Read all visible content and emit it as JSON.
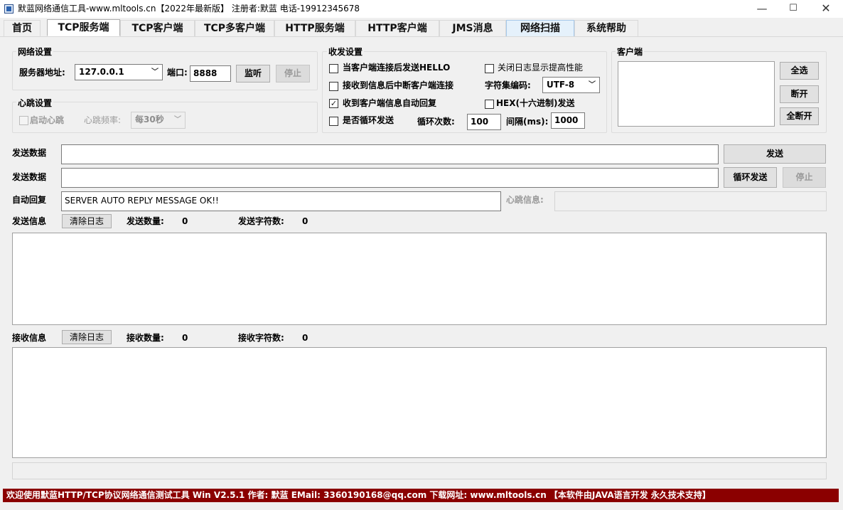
{
  "window": {
    "title": "默蓝网络通信工具-www.mltools.cn【2022年最新版】 注册者:默蓝 电话-19912345678",
    "min": "—",
    "max": "☐",
    "close": "✕"
  },
  "tabs": [
    "首页",
    "TCP服务端",
    "TCP客户端",
    "TCP多客户端",
    "HTTP服务端",
    "HTTP客户端",
    "JMS消息",
    "网络扫描",
    "系统帮助"
  ],
  "active_tab": "TCP服务端",
  "network": {
    "title": "网络设置",
    "server_label": "服务器地址:",
    "server_value": "127.0.0.1",
    "port_label": "端口:",
    "port_value": "8888",
    "listen_btn": "监听",
    "stop_btn": "停止"
  },
  "heartbeat": {
    "title": "心跳设置",
    "enable_label": "启动心跳",
    "freq_label": "心跳频率:",
    "freq_value": "每30秒"
  },
  "txrx": {
    "title": "收发设置",
    "hello_label": "当客户端连接后发送HELLO",
    "close_log_label": "关闭日志显示提高性能",
    "disconnect_label": "接收到信息后中断客户端连接",
    "charset_label": "字符集编码:",
    "charset_value": "UTF-8",
    "auto_reply_label": "收到客户端信息自动回复",
    "auto_reply_checked": true,
    "hex_label": "HEX(十六进制)发送",
    "loop_label": "是否循环发送",
    "loop_count_label": "循环次数:",
    "loop_count_value": "100",
    "interval_label": "间隔(ms):",
    "interval_value": "1000",
    "check_mark": "✓"
  },
  "clients": {
    "title": "客户端",
    "select_all": "全选",
    "disconnect": "断开",
    "disconnect_all": "全断开"
  },
  "send": {
    "label1": "发送数据",
    "label2": "发送数据",
    "value1": "",
    "value2": "",
    "send_btn": "发送",
    "loop_send_btn": "循环发送",
    "stop_btn": "停止"
  },
  "auto_reply": {
    "label": "自动回复",
    "value": "SERVER AUTO REPLY MESSAGE OK!!",
    "heartbeat_label": "心跳信息:",
    "heartbeat_value": ""
  },
  "send_info": {
    "label": "发送信息",
    "clear_btn": "清除日志",
    "count_label": "发送数量:",
    "count_value": "0",
    "chars_label": "发送字符数:",
    "chars_value": "0"
  },
  "recv_info": {
    "label": "接收信息",
    "clear_btn": "清除日志",
    "count_label": "接收数量:",
    "count_value": "0",
    "chars_label": "接收字符数:",
    "chars_value": "0"
  },
  "statusbar": {
    "text": "欢迎使用默蓝HTTP/TCP协议网络通信测试工具 Win V2.5.1  作者: 默蓝  EMail: 3360190168@qq.com  下载网址: www.mltools.cn  【本软件由JAVA语言开发  永久技术支持】",
    "bg": "#8b0000"
  },
  "colors": {
    "tab_hover": "#e5f1fb"
  }
}
